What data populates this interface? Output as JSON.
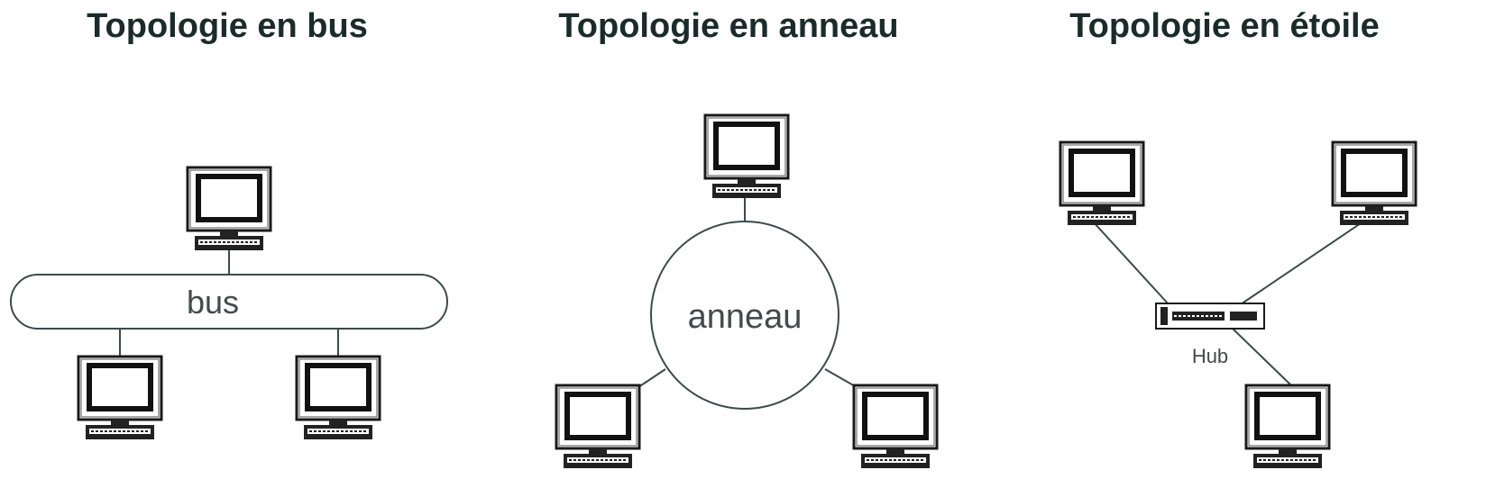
{
  "panels": [
    {
      "title": "Topologie en bus",
      "center_label": "bus"
    },
    {
      "title": "Topologie en anneau",
      "center_label": "anneau"
    },
    {
      "title": "Topologie en étoile",
      "center_label": "Hub"
    }
  ],
  "colors": {
    "line": "#3d4a4a",
    "frame": "#1a1a1a",
    "screen": "#ffffff",
    "title": "#1b2b2b"
  }
}
